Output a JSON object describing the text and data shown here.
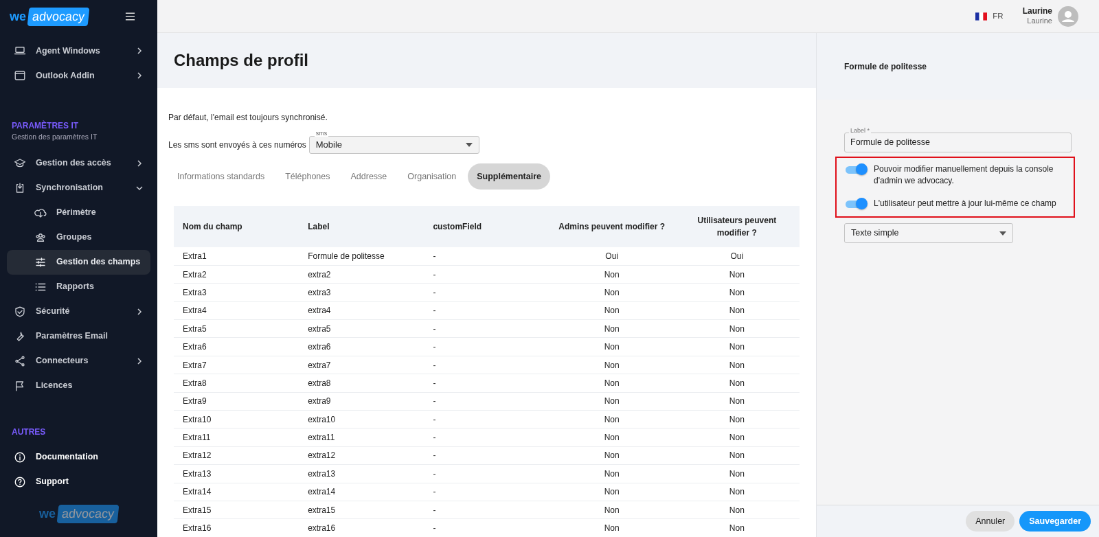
{
  "sidebar": {
    "logo": {
      "prefix": "we",
      "name": "advocacy"
    },
    "top_items": [
      {
        "label": "Agent Windows",
        "expanded": false,
        "selected": false
      },
      {
        "label": "Outlook Addin",
        "expanded": false,
        "selected": false
      }
    ],
    "sections": [
      {
        "title": "PARAMÈTRES IT",
        "subtitle": "Gestion des paramètres IT",
        "items": [
          {
            "label": "Gestion des accès",
            "expanded": false,
            "selected": false
          },
          {
            "label": "Synchronisation",
            "expanded": true,
            "selected": false,
            "children": [
              {
                "label": "Périmètre",
                "selected": false
              },
              {
                "label": "Groupes",
                "selected": false
              },
              {
                "label": "Gestion des champs",
                "selected": true
              },
              {
                "label": "Rapports",
                "selected": false
              }
            ]
          },
          {
            "label": "Sécurité",
            "expanded": false,
            "selected": false
          },
          {
            "label": "Paramètres Email",
            "selected": false
          },
          {
            "label": "Connecteurs",
            "expanded": false,
            "selected": false
          },
          {
            "label": "Licences",
            "selected": false
          }
        ]
      },
      {
        "title": "AUTRES",
        "items": [
          {
            "label": "Documentation",
            "selected": false
          },
          {
            "label": "Support",
            "selected": false
          }
        ]
      }
    ],
    "footer_logo": {
      "prefix": "we",
      "name": "advocacy"
    }
  },
  "topbar": {
    "language": "FR",
    "user_name": "Laurine",
    "user_role": "Laurine"
  },
  "page": {
    "title": "Champs de profil",
    "note": "Par défaut, l'email est toujours synchronisé.",
    "sms": {
      "text": "Les sms sont envoyés à ces numéros",
      "field_label": "sms",
      "value": "Mobile"
    },
    "tabs": [
      {
        "label": "Informations standards",
        "selected": false
      },
      {
        "label": "Téléphones",
        "selected": false
      },
      {
        "label": "Addresse",
        "selected": false
      },
      {
        "label": "Organisation",
        "selected": false
      },
      {
        "label": "Supplémentaire",
        "selected": true
      }
    ],
    "table": {
      "columns": [
        "Nom du champ",
        "Label",
        "customField",
        "Admins peuvent modifier ?",
        "Utilisateurs peuvent modifier ?"
      ],
      "rows": [
        [
          "Extra1",
          "Formule de politesse",
          "-",
          "Oui",
          "Oui"
        ],
        [
          "Extra2",
          "extra2",
          "-",
          "Non",
          "Non"
        ],
        [
          "Extra3",
          "extra3",
          "-",
          "Non",
          "Non"
        ],
        [
          "Extra4",
          "extra4",
          "-",
          "Non",
          "Non"
        ],
        [
          "Extra5",
          "extra5",
          "-",
          "Non",
          "Non"
        ],
        [
          "Extra6",
          "extra6",
          "-",
          "Non",
          "Non"
        ],
        [
          "Extra7",
          "extra7",
          "-",
          "Non",
          "Non"
        ],
        [
          "Extra8",
          "extra8",
          "-",
          "Non",
          "Non"
        ],
        [
          "Extra9",
          "extra9",
          "-",
          "Non",
          "Non"
        ],
        [
          "Extra10",
          "extra10",
          "-",
          "Non",
          "Non"
        ],
        [
          "Extra11",
          "extra11",
          "-",
          "Non",
          "Non"
        ],
        [
          "Extra12",
          "extra12",
          "-",
          "Non",
          "Non"
        ],
        [
          "Extra13",
          "extra13",
          "-",
          "Non",
          "Non"
        ],
        [
          "Extra14",
          "extra14",
          "-",
          "Non",
          "Non"
        ],
        [
          "Extra15",
          "extra15",
          "-",
          "Non",
          "Non"
        ],
        [
          "Extra16",
          "extra16",
          "-",
          "Non",
          "Non"
        ]
      ]
    }
  },
  "panel": {
    "title": "Formule de politesse",
    "label_field": {
      "label": "Label *",
      "value": "Formule de politesse"
    },
    "toggles": [
      {
        "label": "Pouvoir modifier manuellement depuis la console d'admin we advocacy.",
        "on": true
      },
      {
        "label": "L'utilisateur peut mettre à jour lui-même ce champ",
        "on": true
      }
    ],
    "type_select": {
      "value": "Texte simple"
    },
    "buttons": [
      {
        "label": "Annuler",
        "kind": "secondary"
      },
      {
        "label": "Sauvegarder",
        "kind": "primary"
      }
    ]
  }
}
